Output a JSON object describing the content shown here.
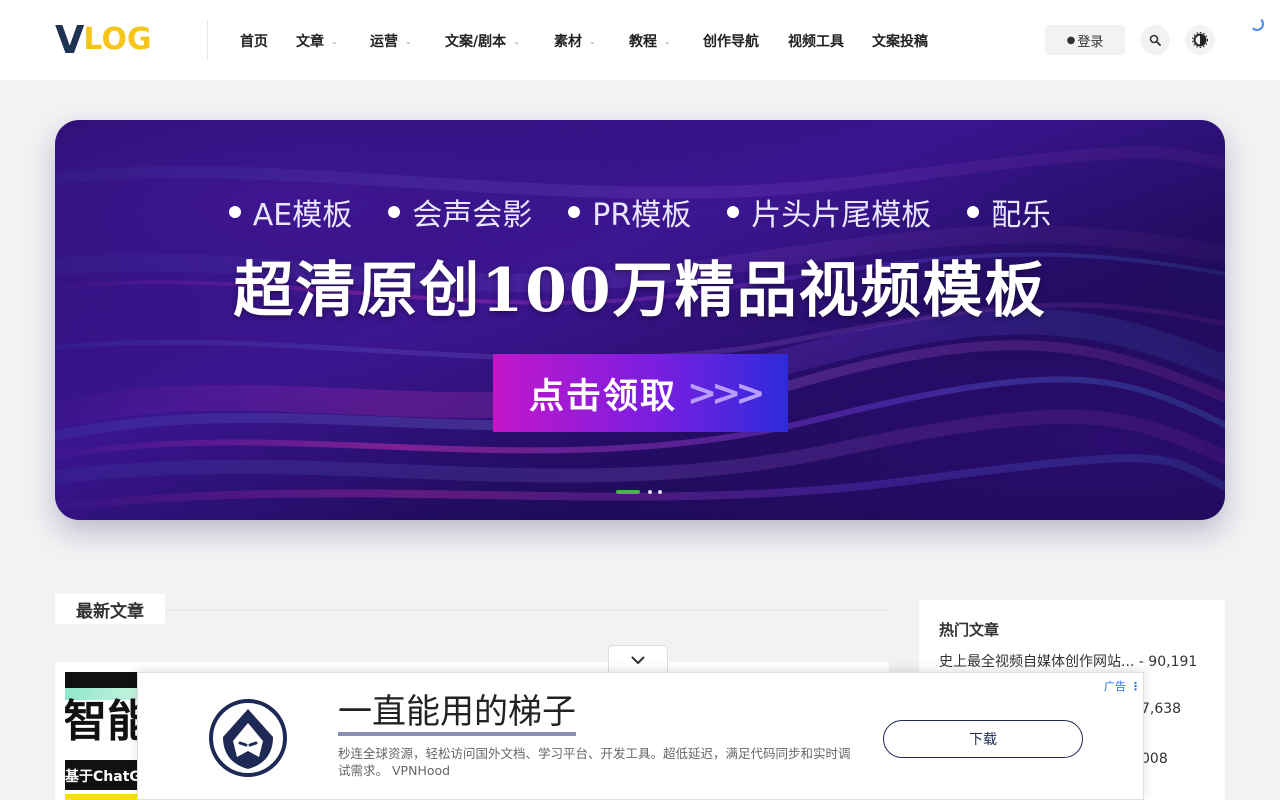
{
  "header": {
    "logo": {
      "v": "V",
      "log": "LOG"
    },
    "nav": [
      {
        "label": "首页",
        "dropdown": false
      },
      {
        "label": "文章",
        "dropdown": true
      },
      {
        "label": "运营",
        "dropdown": true
      },
      {
        "label": "文案/剧本",
        "dropdown": true
      },
      {
        "label": "素材",
        "dropdown": true
      },
      {
        "label": "教程",
        "dropdown": true
      },
      {
        "label": "创作导航",
        "dropdown": false
      },
      {
        "label": "视频工具",
        "dropdown": false
      },
      {
        "label": "文案投稿",
        "dropdown": false
      }
    ],
    "login_label": "登录",
    "icons": {
      "login": "user-icon",
      "search": "search-icon",
      "theme": "theme-toggle-icon",
      "loading": "loading-spinner-icon"
    }
  },
  "banner": {
    "tags": [
      "AE模板",
      "会声会影",
      "PR模板",
      "片头片尾模板",
      "配乐"
    ],
    "title": "超清原创100万精品视频模板",
    "cta": "点击领取",
    "cta_arrows": ">>>",
    "slide_count": 3,
    "active_slide": 1
  },
  "latest": {
    "title": "最新文章",
    "card": {
      "thumb_big": "智能",
      "thumb_band": "基于ChatG"
    }
  },
  "hot": {
    "title": "热门文章",
    "items": [
      {
        "text": "史上最全视频自媒体创作网站... - 90,191"
      },
      {
        "text": "7,638"
      },
      {
        "text": "008"
      }
    ]
  },
  "ad": {
    "badge": "广告",
    "headline": "一直能用的梯子",
    "description": "秒连全球资源，轻松访问国外文档、学习平台、开发工具。超低延迟，满足代码同步和实时调试需求。",
    "advertiser": "VPNHood",
    "button": "下载"
  },
  "colors": {
    "brand_navy": "#1f3350",
    "brand_yellow": "#f5c518",
    "banner_cta_start": "#c317c9",
    "banner_cta_end": "#2e2bdb",
    "slider_active": "#4caf50",
    "ad_badge": "#1a73e8"
  }
}
